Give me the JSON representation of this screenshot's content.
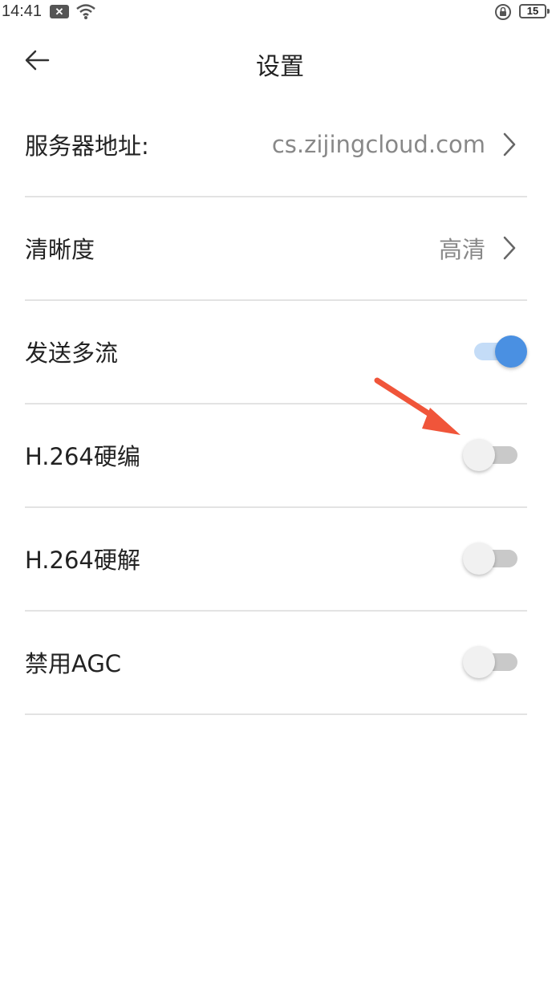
{
  "status_bar": {
    "time": "14:41",
    "notification_icon": "close-box-icon",
    "wifi_icon": "wifi-icon",
    "lock_icon": "lock-rotation-icon",
    "battery_level": "15"
  },
  "header": {
    "back_icon": "arrow-left-icon",
    "title": "设置"
  },
  "settings": {
    "server": {
      "label": "服务器地址:",
      "value": "cs.zijingcloud.com"
    },
    "clarity": {
      "label": "清晰度",
      "value": "高清"
    },
    "multi_stream": {
      "label": "发送多流",
      "enabled": true
    },
    "h264_encode": {
      "label": "H.264硬编",
      "enabled": false
    },
    "h264_decode": {
      "label": "H.264硬解",
      "enabled": false
    },
    "disable_agc": {
      "label": "禁用AGC",
      "enabled": false
    }
  },
  "colors": {
    "accent": "#4a90e2",
    "annotation_arrow": "#f0553a",
    "divider": "#e3e3e3"
  }
}
